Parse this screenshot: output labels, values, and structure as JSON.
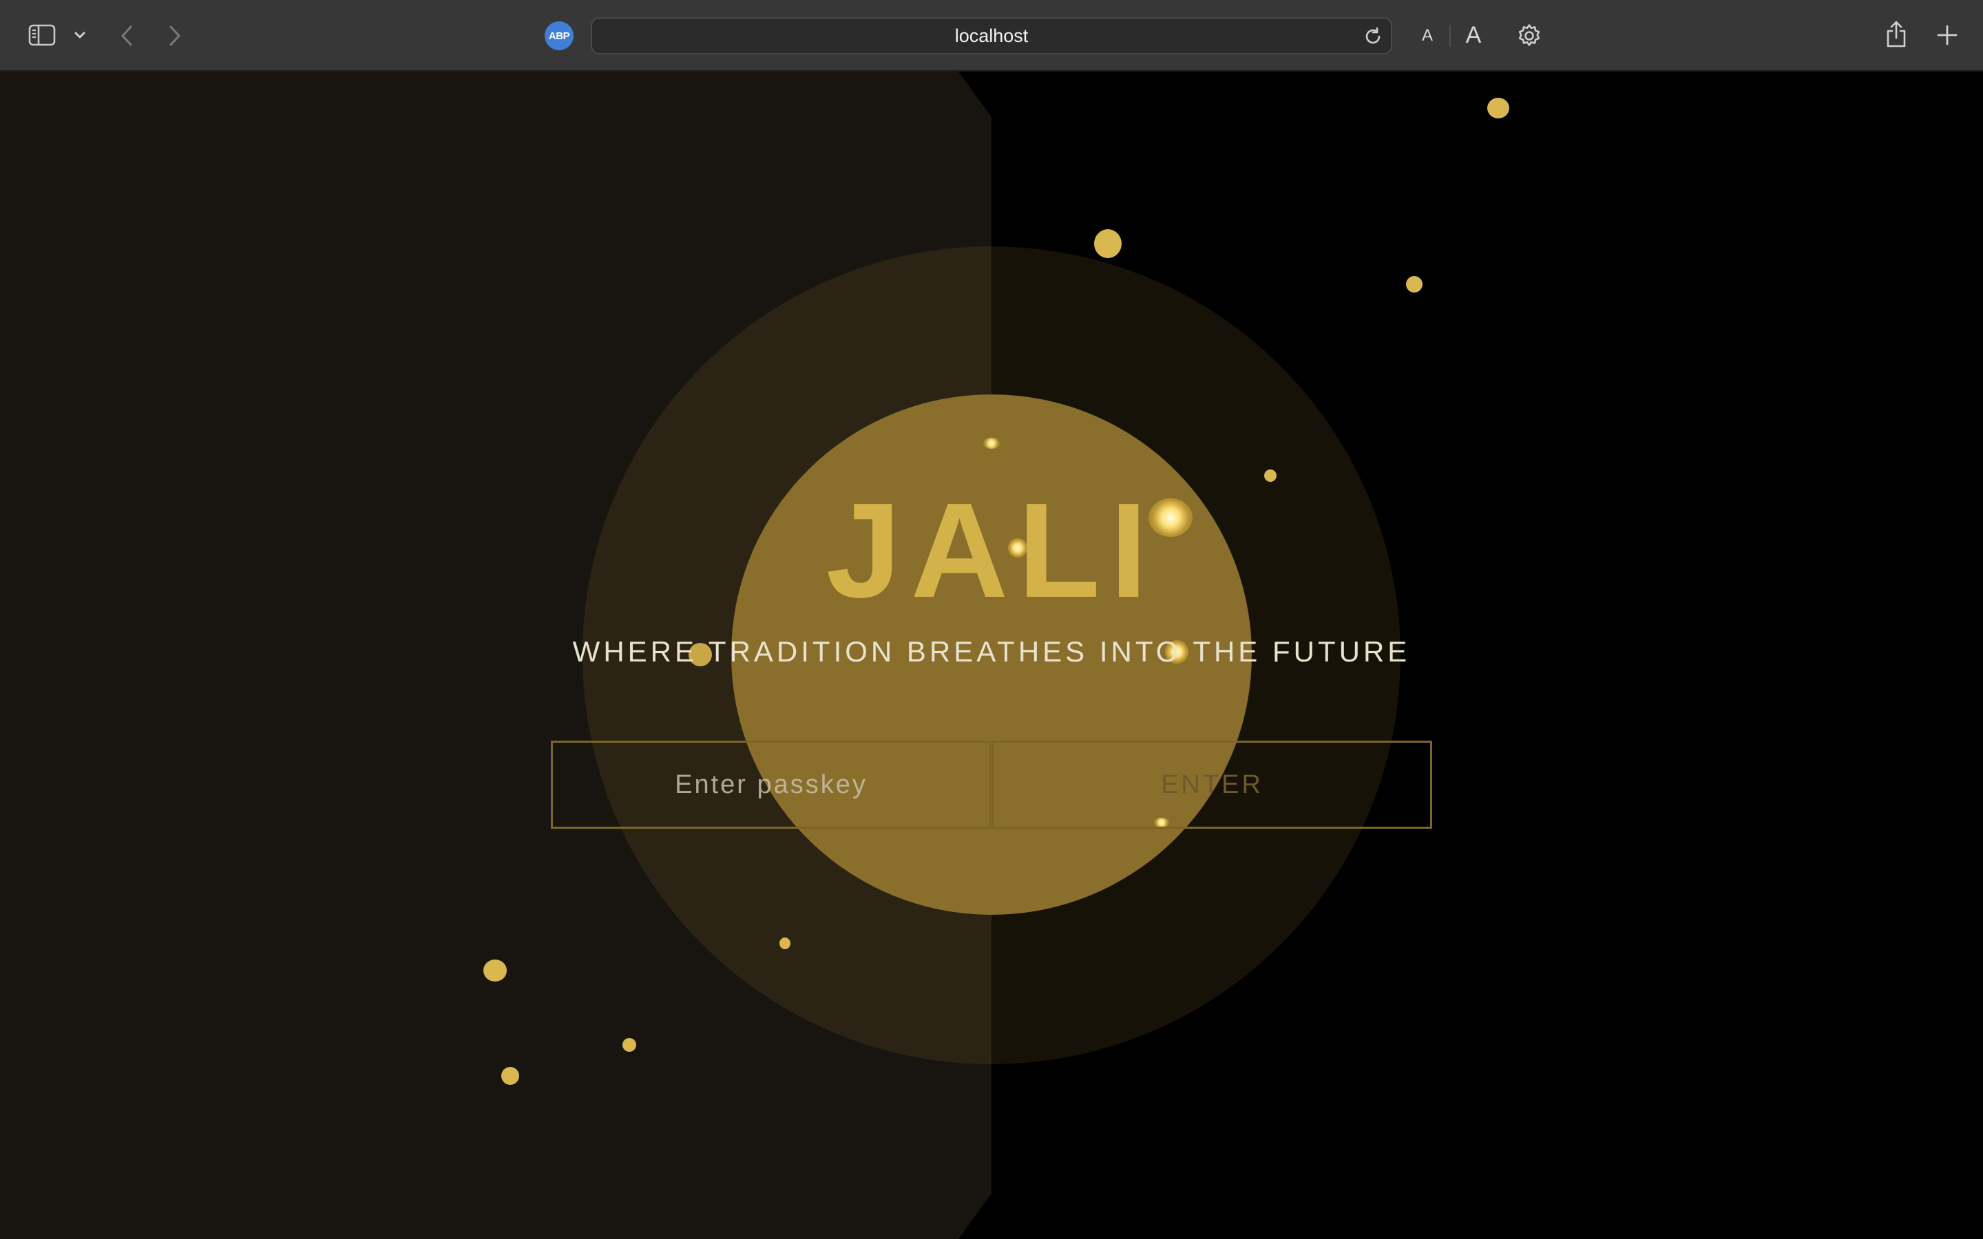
{
  "browser": {
    "url": "localhost",
    "extension_badge": "ABP",
    "font_small_label": "A",
    "font_large_label": "A",
    "icons": [
      "sidebar-icon",
      "chevron-down-icon",
      "back-icon",
      "forward-icon",
      "reload-icon",
      "gear-icon",
      "share-icon",
      "plus-icon"
    ]
  },
  "page": {
    "title": "JALI",
    "tagline": "WHERE TRADITION BREATHES INTO THE FUTURE",
    "passkey": {
      "placeholder": "Enter passkey",
      "value": ""
    },
    "enter_label": "ENTER"
  },
  "colors": {
    "accent_gold": "#d3b24a",
    "disc": "#8a6f2c",
    "left_panel": "#181510",
    "background": "#000000",
    "border": "#7d6526",
    "toolbar": "#373737"
  }
}
